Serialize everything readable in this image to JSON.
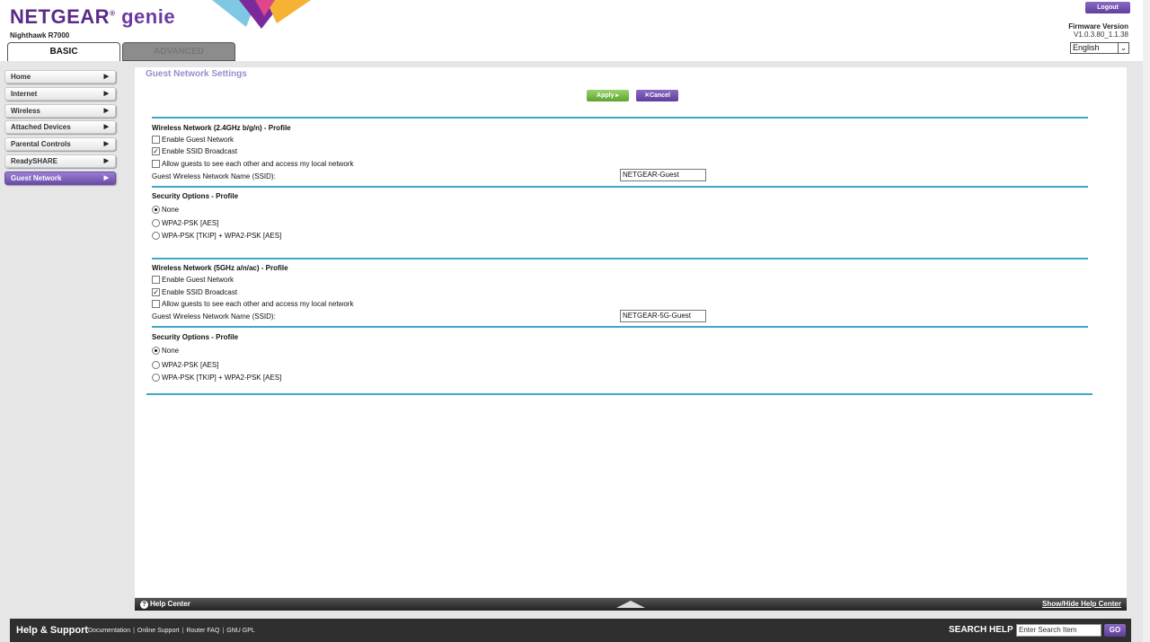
{
  "header": {
    "brand": "NETGEAR",
    "brand_suffix": "genie",
    "registered": "®",
    "model": "Nighthawk R7000",
    "tabs": [
      {
        "label": "BASIC"
      },
      {
        "label": "ADVANCED"
      }
    ],
    "logout_label": "Logout",
    "firmware_label": "Firmware Version",
    "firmware_value": "V1.0.3.80_1.1.38",
    "language": "English"
  },
  "sidebar": {
    "items": [
      {
        "label": "Home"
      },
      {
        "label": "Internet"
      },
      {
        "label": "Wireless"
      },
      {
        "label": "Attached Devices"
      },
      {
        "label": "Parental Controls"
      },
      {
        "label": "ReadySHARE"
      },
      {
        "label": "Guest Network"
      }
    ]
  },
  "main": {
    "title": "Guest Network Settings",
    "apply_label": "Apply ▸",
    "cancel_label": "Cancel",
    "band24": {
      "title": "Wireless Network (2.4GHz b/g/n) - Profile",
      "enable_guest": "Enable Guest Network",
      "enable_guest_checked": false,
      "enable_ssid": "Enable SSID Broadcast",
      "enable_ssid_checked": true,
      "allow_guests": "Allow guests to see each other and access my local network",
      "allow_guests_checked": false,
      "ssid_label": "Guest Wireless Network Name (SSID):",
      "ssid_value": "NETGEAR-Guest",
      "security_title": "Security Options - Profile",
      "options": [
        "None",
        "WPA2-PSK [AES]",
        "WPA-PSK [TKIP] + WPA2-PSK [AES]"
      ],
      "selected_option": "None"
    },
    "band5": {
      "title": "Wireless Network (5GHz a/n/ac) - Profile",
      "enable_guest": "Enable Guest Network",
      "enable_guest_checked": false,
      "enable_ssid": "Enable SSID Broadcast",
      "enable_ssid_checked": true,
      "allow_guests": "Allow guests to see each other and access my local network",
      "allow_guests_checked": false,
      "ssid_label": "Guest Wireless Network Name (SSID):",
      "ssid_value": "NETGEAR-5G-Guest",
      "security_title": "Security Options - Profile",
      "options": [
        "None",
        "WPA2-PSK [AES]",
        "WPA-PSK [TKIP] + WPA2-PSK [AES]"
      ],
      "selected_option": "None"
    }
  },
  "helpbar": {
    "left_label": "Help Center",
    "right_label": "Show/Hide Help Center"
  },
  "footer": {
    "title": "Help & Support",
    "links": [
      "Documentation",
      "Online Support",
      "Router FAQ",
      "GNU GPL"
    ],
    "search_label": "SEARCH HELP",
    "search_placeholder": "Enter Search Item",
    "go_label": "GO"
  },
  "colors": {
    "accent_purple": "#6b4ba9",
    "accent_teal": "#3ca7c8",
    "apply_green": "#5da22f"
  }
}
